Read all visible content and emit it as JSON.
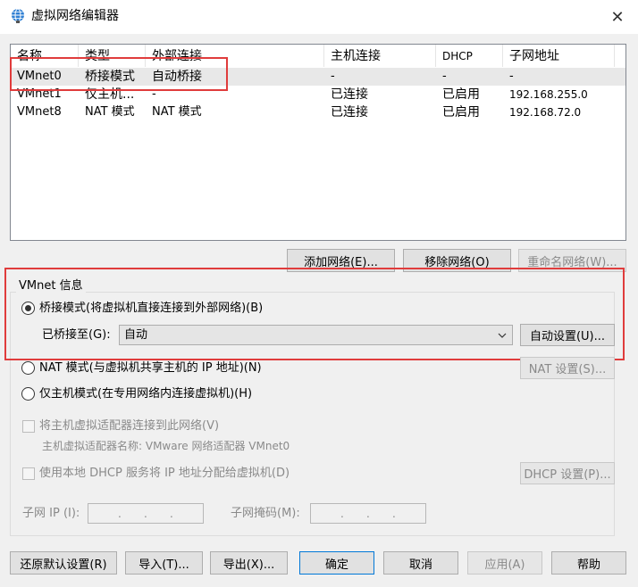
{
  "window": {
    "title": "虚拟网络编辑器",
    "icon": "globe-network-icon",
    "close_glyph": "✕"
  },
  "table": {
    "headers": [
      "名称",
      "类型",
      "外部连接",
      "主机连接",
      "DHCP",
      "子网地址"
    ],
    "rows": [
      {
        "name": "VMnet0",
        "type": "桥接模式",
        "external": "自动桥接",
        "host": "-",
        "dhcp": "-",
        "subnet": "-"
      },
      {
        "name": "VMnet1",
        "type": "仅主机...",
        "external": "-",
        "host": "已连接",
        "dhcp": "已启用",
        "subnet": "192.168.255.0"
      },
      {
        "name": "VMnet8",
        "type": "NAT 模式",
        "external": "NAT 模式",
        "host": "已连接",
        "dhcp": "已启用",
        "subnet": "192.168.72.0"
      }
    ]
  },
  "table_buttons": {
    "add": "添加网络(E)...",
    "remove": "移除网络(O)",
    "rename": "重命名网络(W)..."
  },
  "vmnet_info": {
    "label": "VMnet 信息",
    "bridged_radio": "桥接模式(将虚拟机直接连接到外部网络)(B)",
    "bridged_to_label": "已桥接至(G):",
    "bridged_to_value": "自动",
    "auto_settings_button": "自动设置(U)...",
    "nat_radio": "NAT 模式(与虚拟机共享主机的 IP 地址)(N)",
    "nat_settings_button": "NAT 设置(S)...",
    "hostonly_radio": "仅主机模式(在专用网络内连接虚拟机)(H)",
    "connect_adapter_checkbox": "将主机虚拟适配器连接到此网络(V)",
    "adapter_name_text": "主机虚拟适配器名称: VMware 网络适配器 VMnet0",
    "dhcp_checkbox": "使用本地 DHCP 服务将 IP 地址分配给虚拟机(D)",
    "dhcp_settings_button": "DHCP 设置(P)...",
    "subnet_ip_label": "子网 IP (I):",
    "subnet_mask_label": "子网掩码(M):",
    "selected_mode": "bridged"
  },
  "footer_buttons": {
    "restore": "还原默认设置(R)",
    "import": "导入(T)...",
    "export": "导出(X)...",
    "ok": "确定",
    "cancel": "取消",
    "apply": "应用(A)",
    "help": "帮助"
  },
  "colors": {
    "highlight_red": "#e03c3c",
    "focus_blue": "#0078d7"
  }
}
